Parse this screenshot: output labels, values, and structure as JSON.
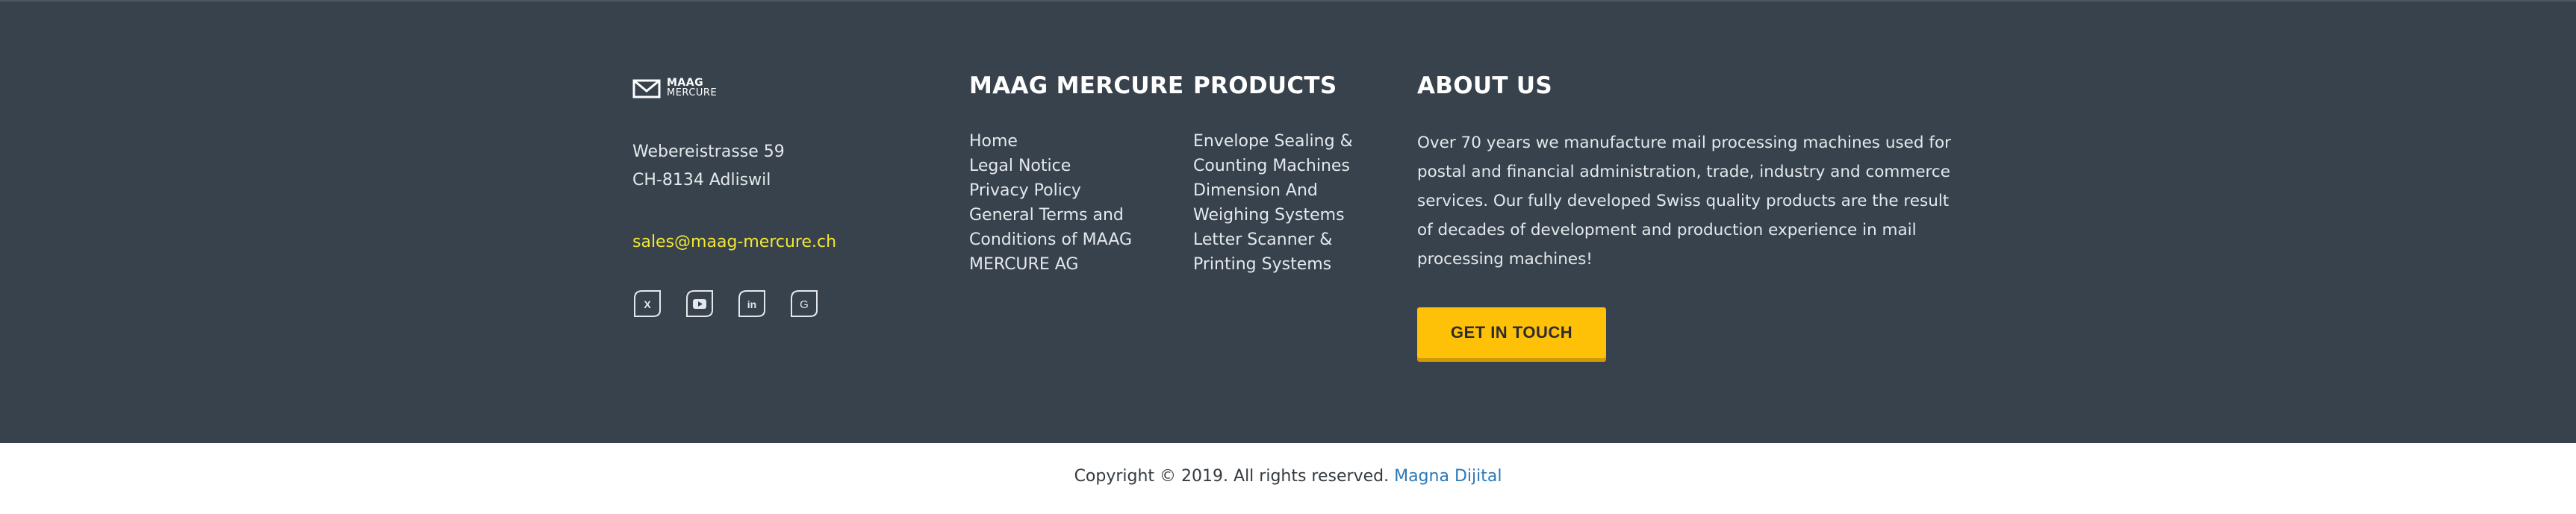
{
  "brand": {
    "logo_line1": "MAAG",
    "logo_line2": "MERCURE"
  },
  "contact": {
    "street": "Webereistrasse 59",
    "city": "CH-8134 Adliswil",
    "email": "sales@maag-mercure.ch"
  },
  "social": [
    {
      "icon": "xing-icon",
      "glyph": "X"
    },
    {
      "icon": "youtube-icon",
      "glyph": "▶"
    },
    {
      "icon": "linkedin-icon",
      "glyph": "in"
    },
    {
      "icon": "google-icon",
      "glyph": "G"
    }
  ],
  "columns": {
    "company": {
      "title": "MAAG MERCURE",
      "links": [
        "Home",
        "Legal Notice",
        "Privacy Policy",
        "General Terms and",
        "Conditions of MAAG",
        "MERCURE AG"
      ]
    },
    "products": {
      "title": "PRODUCTS",
      "links": [
        "Envelope Sealing &",
        "Counting Machines",
        "Dimension And",
        "Weighing Systems",
        "Letter Scanner &",
        "Printing Systems"
      ]
    },
    "about": {
      "title": "ABOUT US",
      "text": "Over 70 years we manufacture mail processing machines used for postal and financial administration, trade, industry and commerce services. Our fully developed Swiss quality products are the result of decades of development and production experience in mail processing machines!",
      "cta": "GET IN TOUCH"
    }
  },
  "copyright": {
    "text": "Copyright © 2019. All rights reserved.",
    "link": "Magna Dijital"
  },
  "colors": {
    "footer_bg": "#37424c",
    "accent_yellow": "#ffc107",
    "email": "#f2e733",
    "link_blue": "#2a78b8"
  }
}
